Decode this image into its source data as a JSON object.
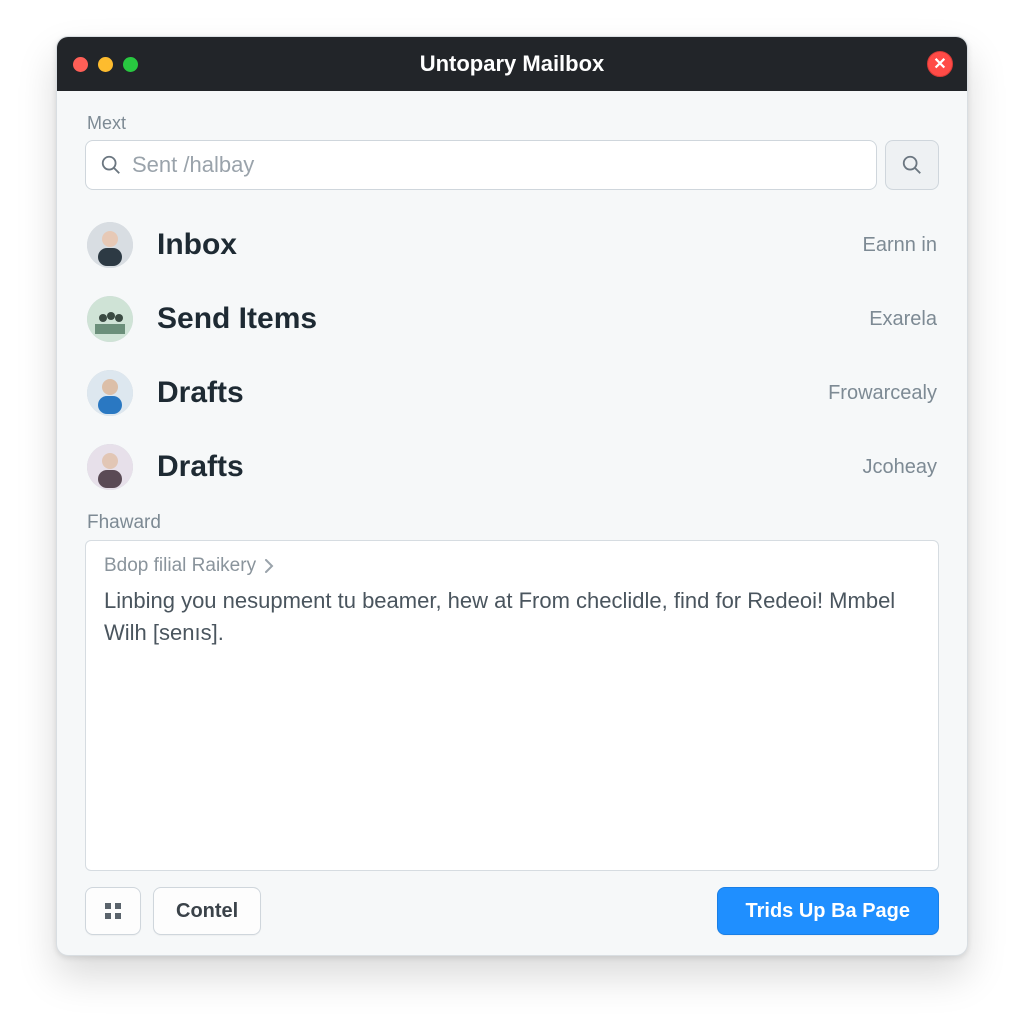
{
  "window": {
    "title": "Untopary Mailbox"
  },
  "header": {
    "label": "Mext"
  },
  "search": {
    "placeholder": "Sent /halbay",
    "value": ""
  },
  "folders": [
    {
      "label": "Inbox",
      "meta": "Earnn in"
    },
    {
      "label": "Send Items",
      "meta": "Exarela"
    },
    {
      "label": "Drafts",
      "meta": "Frowarcealy"
    },
    {
      "label": "Drafts",
      "meta": "Jcoheay"
    }
  ],
  "preview": {
    "section_label": "Fhaward",
    "crumb": "Bdop filial Raikery",
    "body": "Linbing you nesupment tu beamer, hew at From checlidle, find for Redeoi! Mmbel Wilh [senıs]."
  },
  "footer": {
    "cancel_label": "Contel",
    "primary_label": "Trids Up Ba Page"
  },
  "icons": {
    "close": "✕"
  },
  "colors": {
    "accent": "#1f8fff",
    "titlebar": "#222529"
  }
}
